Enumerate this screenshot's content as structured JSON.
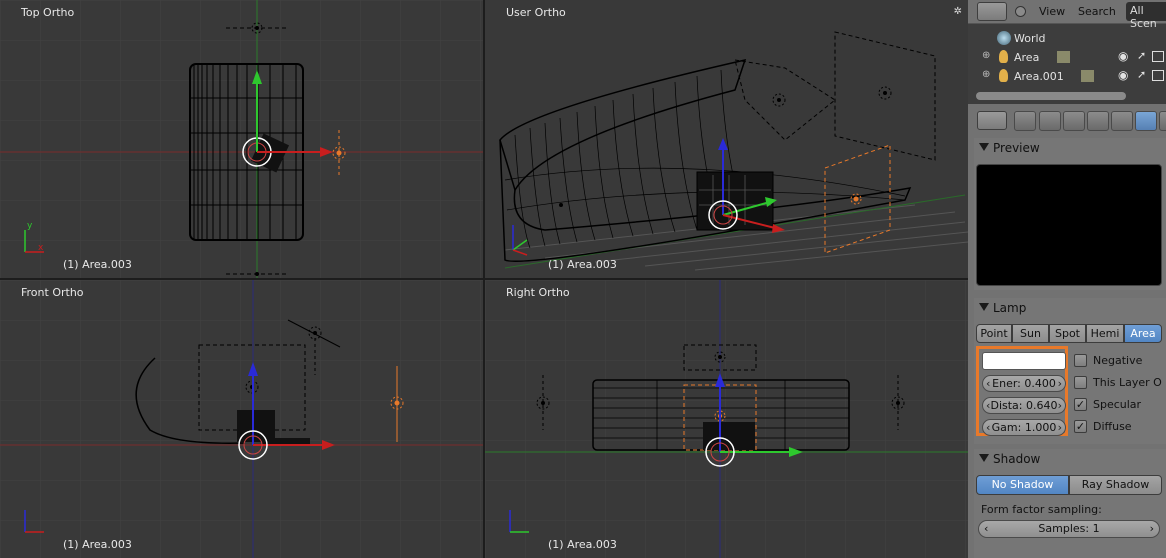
{
  "viewports": {
    "top_left": {
      "title": "Top Ortho",
      "object_label": "(1) Area.003"
    },
    "top_right": {
      "title": "User Ortho",
      "object_label": "(1) Area.003"
    },
    "bottom_left": {
      "title": "Front Ortho",
      "object_label": "(1) Area.003"
    },
    "bottom_right": {
      "title": "Right Ortho",
      "object_label": "(1) Area.003"
    }
  },
  "outliner": {
    "menu": {
      "view": "View",
      "search": "Search",
      "scene_selector": "All Scen"
    },
    "items": [
      {
        "label": "World",
        "icon": "world-icon"
      },
      {
        "label": "Area",
        "icon": "lamp-icon"
      },
      {
        "label": "Area.001",
        "icon": "lamp-icon"
      }
    ]
  },
  "properties": {
    "preview": {
      "header": "Preview"
    },
    "lamp": {
      "header": "Lamp",
      "types": [
        "Point",
        "Sun",
        "Spot",
        "Hemi",
        "Area"
      ],
      "selected_type": "Area",
      "energy": "Ener: 0.400",
      "distance": "Dista: 0.640",
      "gamma": "Gam: 1.000",
      "checkboxes": [
        {
          "label": "Negative",
          "checked": false
        },
        {
          "label": "This Layer O",
          "checked": false
        },
        {
          "label": "Specular",
          "checked": true
        },
        {
          "label": "Diffuse",
          "checked": true
        }
      ]
    },
    "shadow": {
      "header": "Shadow",
      "options": [
        "No Shadow",
        "Ray Shadow"
      ],
      "selected": "No Shadow",
      "form_factor_label": "Form factor sampling:",
      "samples": "Samples: 1"
    }
  },
  "colors": {
    "viewport_bg": "#393939",
    "accent_blue": "#5286c4",
    "highlight_orange": "#e8792a",
    "axis_red": "#c81e1e",
    "axis_green": "#2ec82e",
    "axis_blue": "#2a2ad8"
  }
}
